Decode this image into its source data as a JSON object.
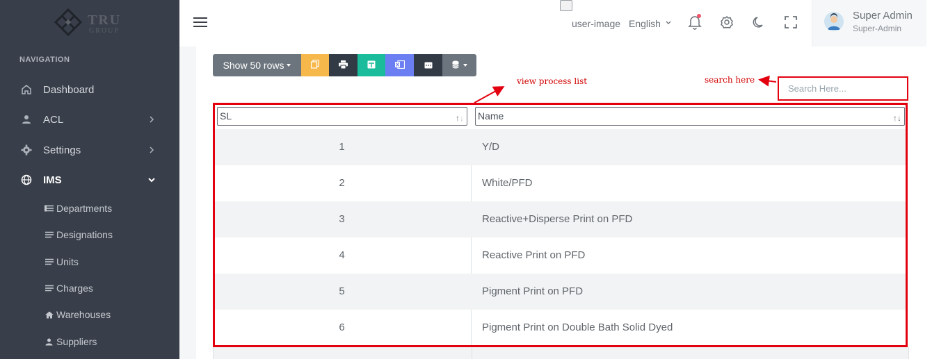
{
  "brand": {
    "name": "TRU",
    "sub": "GROUP"
  },
  "sidebar": {
    "heading": "NAVIGATION",
    "items": [
      {
        "label": "Dashboard",
        "icon": "home-icon"
      },
      {
        "label": "ACL",
        "icon": "user-icon"
      },
      {
        "label": "Settings",
        "icon": "gear-icon"
      },
      {
        "label": "IMS",
        "icon": "globe-icon"
      }
    ],
    "sub_items": [
      {
        "label": "Departments",
        "icon": "list-icon"
      },
      {
        "label": "Designations",
        "icon": "lines-icon"
      },
      {
        "label": "Units",
        "icon": "lines-icon"
      },
      {
        "label": "Charges",
        "icon": "lines-icon"
      },
      {
        "label": "Warehouses",
        "icon": "home-small-icon"
      },
      {
        "label": "Suppliers",
        "icon": "user-small-icon"
      }
    ]
  },
  "topbar": {
    "user_image_alt": "user-image",
    "language": "English",
    "user": {
      "name": "Super Admin",
      "role": "Super-Admin"
    }
  },
  "toolbar": {
    "show_rows": "Show 50 rows",
    "colors": {
      "copy": "#f7b84b",
      "print": "#323a46",
      "csv": "#1abc9c",
      "excel": "#6c7ff2",
      "pdf": "#323a46",
      "secondary": "#6c757d"
    }
  },
  "search": {
    "placeholder": "Search Here..."
  },
  "annotations": {
    "view": "view process list",
    "search": "search here",
    "color": "#e3000f"
  },
  "table": {
    "columns": [
      "SL",
      "Name"
    ],
    "rows": [
      {
        "sl": "1",
        "name": "Y/D"
      },
      {
        "sl": "2",
        "name": "White/PFD"
      },
      {
        "sl": "3",
        "name": "Reactive+Disperse Print on PFD"
      },
      {
        "sl": "4",
        "name": "Reactive Print on PFD"
      },
      {
        "sl": "5",
        "name": "Pigment Print on PFD"
      },
      {
        "sl": "6",
        "name": "Pigment Print on Double Bath Solid Dyed"
      }
    ]
  }
}
